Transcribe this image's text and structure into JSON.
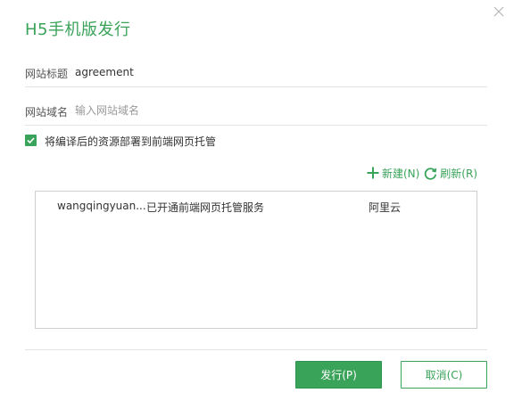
{
  "dialog": {
    "title": "H5手机版发行"
  },
  "form": {
    "site_title_label": "网站标题",
    "site_title_value": "agreement",
    "site_domain_label": "网站域名",
    "site_domain_placeholder": "输入网站域名",
    "site_domain_value": "",
    "deploy_checkbox_label": "将编译后的资源部署到前端网页托管",
    "deploy_checked": true
  },
  "toolbar": {
    "new_label": "新建(N)",
    "refresh_label": "刷新(R)"
  },
  "hosting_list": {
    "rows": [
      {
        "name": "wangqingyuan...",
        "status": "已开通前端网页托管服务",
        "provider": "阿里云"
      }
    ]
  },
  "footer": {
    "publish_label": "发行(P)",
    "cancel_label": "取消(C)"
  },
  "colors": {
    "accent": "#3aa35a",
    "border": "#cfcfcf",
    "divider": "#e2e2e2"
  },
  "icons": {
    "close": "close-icon",
    "check": "check-icon",
    "new": "plus-icon",
    "refresh": "refresh-icon"
  }
}
